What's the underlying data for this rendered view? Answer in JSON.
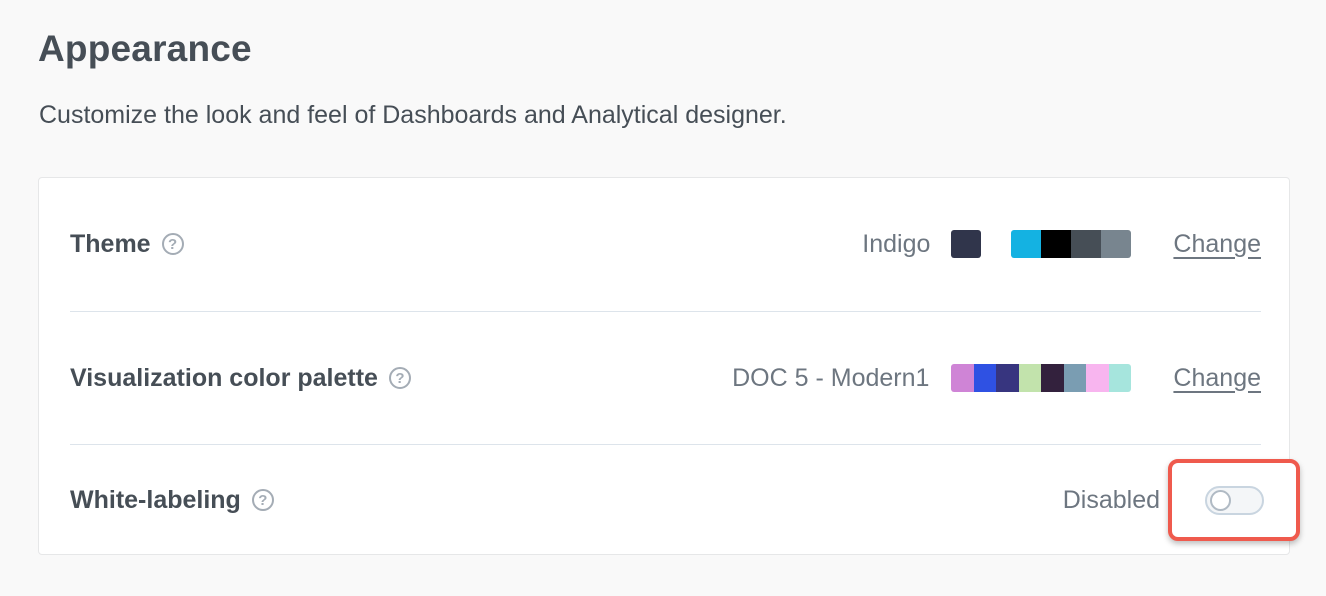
{
  "page": {
    "title": "Appearance",
    "subtitle": "Customize the look and feel of Dashboards and Analytical designer."
  },
  "settings": {
    "theme": {
      "label": "Theme",
      "help_icon": "question-circle-icon",
      "value": "Indigo",
      "swatch_color": "#30354b",
      "strip_colors": [
        "#14b2e2",
        "#000000",
        "#464e56",
        "#78858f"
      ],
      "change_label": "Change"
    },
    "palette": {
      "label": "Visualization color palette",
      "help_icon": "question-circle-icon",
      "value": "DOC 5 - Modern1",
      "colors": [
        "#cf84d6",
        "#2f51e3",
        "#37357f",
        "#c2e3ac",
        "#33213d",
        "#7a9db2",
        "#f8b5ef",
        "#a6e5dd"
      ],
      "change_label": "Change"
    },
    "white_labeling": {
      "label": "White-labeling",
      "help_icon": "question-circle-icon",
      "status": "Disabled",
      "enabled": false
    }
  },
  "colors": {
    "highlight": "#ef5a4d",
    "text": "#464e56",
    "muted_text": "#6d7680"
  }
}
